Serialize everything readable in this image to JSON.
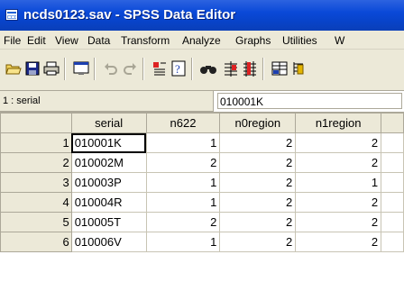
{
  "window": {
    "title": "ncds0123.sav - SPSS Data Editor"
  },
  "menu": [
    "File",
    "Edit",
    "View",
    "Data",
    "Transform",
    "Analyze",
    "Graphs",
    "Utilities",
    "W"
  ],
  "toolbar": {
    "icons": [
      "open-icon",
      "save-icon",
      "print-icon",
      "dialog-recall-icon",
      "undo-icon",
      "redo-icon",
      "goto-case-icon",
      "variables-icon",
      "find-icon",
      "insert-case-icon",
      "insert-variable-icon",
      "split-file-icon",
      "weight-cases-icon"
    ]
  },
  "cell_editor": {
    "reference": "1 : serial",
    "value": "010001K"
  },
  "grid": {
    "columns": [
      "serial",
      "n622",
      "n0region",
      "n1region"
    ],
    "rows": [
      {
        "num": "1",
        "cells": [
          "010001K",
          "1",
          "2",
          "2"
        ]
      },
      {
        "num": "2",
        "cells": [
          "010002M",
          "2",
          "2",
          "2"
        ]
      },
      {
        "num": "3",
        "cells": [
          "010003P",
          "1",
          "2",
          "1"
        ]
      },
      {
        "num": "4",
        "cells": [
          "010004R",
          "1",
          "2",
          "2"
        ]
      },
      {
        "num": "5",
        "cells": [
          "010005T",
          "2",
          "2",
          "2"
        ]
      },
      {
        "num": "6",
        "cells": [
          "010006V",
          "1",
          "2",
          "2"
        ]
      }
    ]
  }
}
